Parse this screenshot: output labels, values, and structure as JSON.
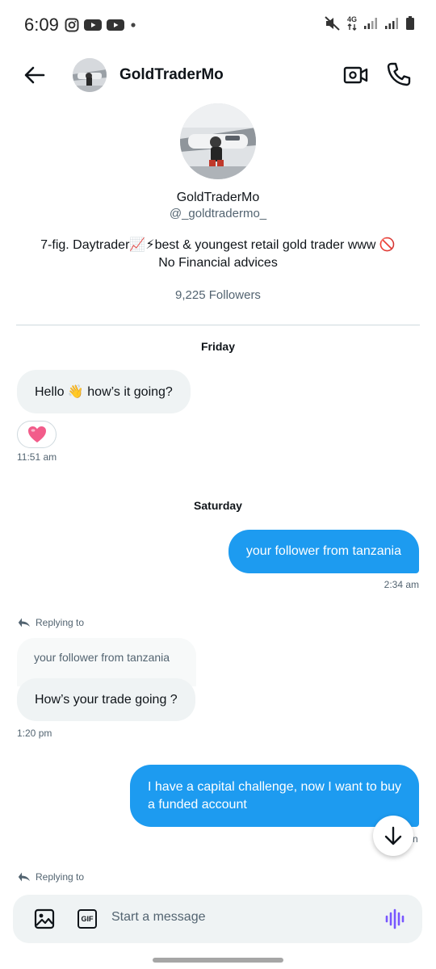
{
  "status_bar": {
    "time": "6:09",
    "network": "4G"
  },
  "header": {
    "back_icon": "arrow-left-icon",
    "name": "GoldTraderMo",
    "video_icon": "video-call-icon",
    "phone_icon": "phone-icon"
  },
  "profile": {
    "name": "GoldTraderMo",
    "handle": "@_goldtradermo_",
    "bio_line1": "7-fig. Daytrader📈⚡best & youngest retail gold trader www 🚫",
    "bio_line2": "No Financial advices",
    "followers": "9,225 Followers"
  },
  "conversation": {
    "day1": "Friday",
    "msg1": "Hello 👋 how’s it going?",
    "reaction": "🩷",
    "time1": "11:51 am",
    "day2": "Saturday",
    "msg2": "your follower from tanzania",
    "time2": "2:34 am",
    "replying1": "Replying to",
    "quoted": "your follower from tanzania",
    "msg3": "How’s your trade going ?",
    "time3": "1:20 pm",
    "msg4_line1": "I have a capital challenge, now I want to buy",
    "msg4_line2": "a funded account",
    "time4_partial": "n",
    "replying2": "Replying to"
  },
  "composer": {
    "placeholder": "Start a message",
    "gif_label": "GIF"
  },
  "colors": {
    "accent": "#1d9bf0",
    "incoming_bubble": "#eff3f4",
    "muted_text": "#536471",
    "voice_icon": "#7856ff"
  }
}
